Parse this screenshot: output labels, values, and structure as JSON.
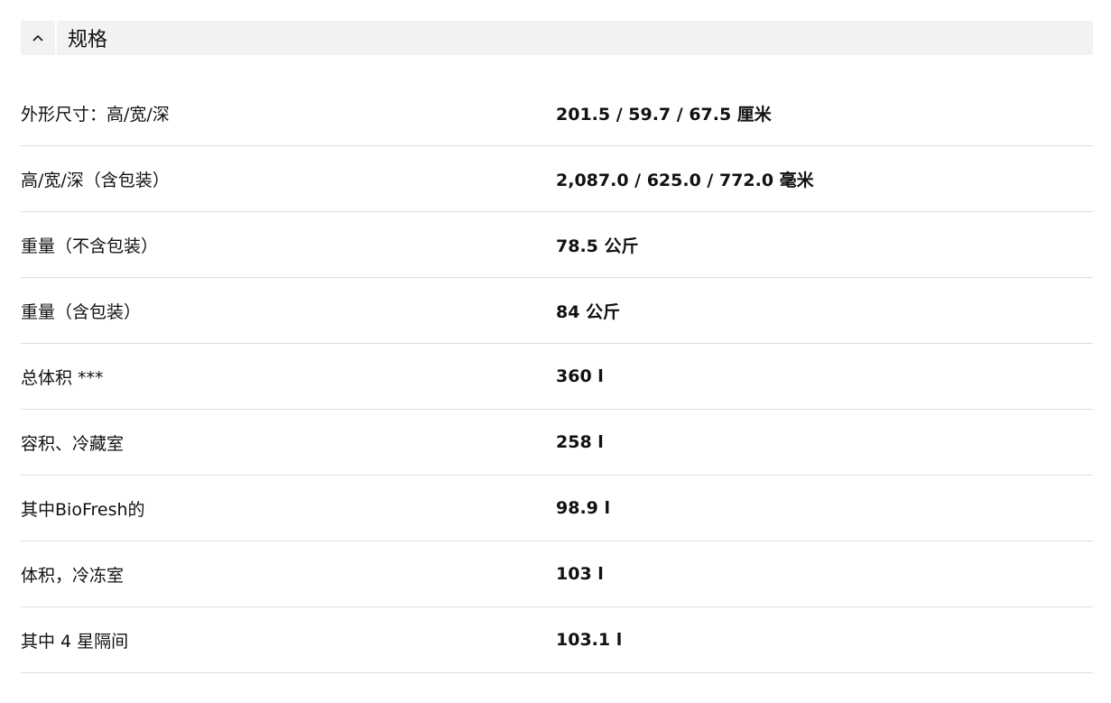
{
  "section": {
    "title": "规格",
    "toggle_icon": "chevron-up-icon"
  },
  "specs": [
    {
      "label": "外形尺寸：高/宽/深",
      "value": "201.5 / 59.7 / 67.5 厘米"
    },
    {
      "label": "高/宽/深（含包装）",
      "value": "2,087.0 / 625.0 / 772.0 毫米"
    },
    {
      "label": "重量（不含包装）",
      "value": "78.5 公斤"
    },
    {
      "label": "重量（含包装）",
      "value": "84 公斤"
    },
    {
      "label": "总体积 ***",
      "value": "360 l"
    },
    {
      "label": "容积、冷藏室",
      "value": "258 l"
    },
    {
      "label": "其中BioFresh的",
      "value": "98.9 l"
    },
    {
      "label": "体积，冷冻室",
      "value": "103 l"
    },
    {
      "label": "其中 4 星隔间",
      "value": "103.1 l"
    }
  ]
}
